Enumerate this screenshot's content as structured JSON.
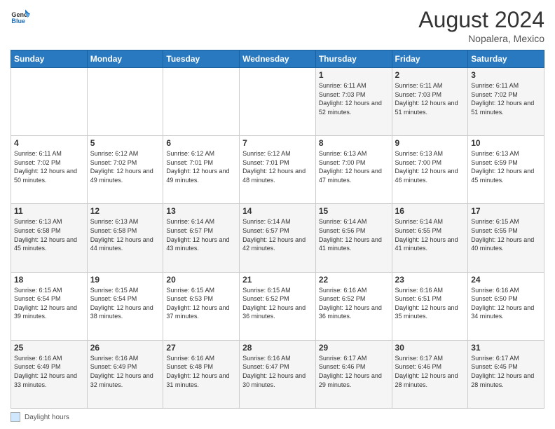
{
  "header": {
    "logo_general": "General",
    "logo_blue": "Blue",
    "month_year": "August 2024",
    "location": "Nopalera, Mexico"
  },
  "footer": {
    "label": "Daylight hours"
  },
  "days": [
    "Sunday",
    "Monday",
    "Tuesday",
    "Wednesday",
    "Thursday",
    "Friday",
    "Saturday"
  ],
  "weeks": [
    [
      {
        "day": "",
        "info": ""
      },
      {
        "day": "",
        "info": ""
      },
      {
        "day": "",
        "info": ""
      },
      {
        "day": "",
        "info": ""
      },
      {
        "day": "1",
        "info": "Sunrise: 6:11 AM\nSunset: 7:03 PM\nDaylight: 12 hours\nand 52 minutes."
      },
      {
        "day": "2",
        "info": "Sunrise: 6:11 AM\nSunset: 7:03 PM\nDaylight: 12 hours\nand 51 minutes."
      },
      {
        "day": "3",
        "info": "Sunrise: 6:11 AM\nSunset: 7:02 PM\nDaylight: 12 hours\nand 51 minutes."
      }
    ],
    [
      {
        "day": "4",
        "info": "Sunrise: 6:11 AM\nSunset: 7:02 PM\nDaylight: 12 hours\nand 50 minutes."
      },
      {
        "day": "5",
        "info": "Sunrise: 6:12 AM\nSunset: 7:02 PM\nDaylight: 12 hours\nand 49 minutes."
      },
      {
        "day": "6",
        "info": "Sunrise: 6:12 AM\nSunset: 7:01 PM\nDaylight: 12 hours\nand 49 minutes."
      },
      {
        "day": "7",
        "info": "Sunrise: 6:12 AM\nSunset: 7:01 PM\nDaylight: 12 hours\nand 48 minutes."
      },
      {
        "day": "8",
        "info": "Sunrise: 6:13 AM\nSunset: 7:00 PM\nDaylight: 12 hours\nand 47 minutes."
      },
      {
        "day": "9",
        "info": "Sunrise: 6:13 AM\nSunset: 7:00 PM\nDaylight: 12 hours\nand 46 minutes."
      },
      {
        "day": "10",
        "info": "Sunrise: 6:13 AM\nSunset: 6:59 PM\nDaylight: 12 hours\nand 45 minutes."
      }
    ],
    [
      {
        "day": "11",
        "info": "Sunrise: 6:13 AM\nSunset: 6:58 PM\nDaylight: 12 hours\nand 45 minutes."
      },
      {
        "day": "12",
        "info": "Sunrise: 6:13 AM\nSunset: 6:58 PM\nDaylight: 12 hours\nand 44 minutes."
      },
      {
        "day": "13",
        "info": "Sunrise: 6:14 AM\nSunset: 6:57 PM\nDaylight: 12 hours\nand 43 minutes."
      },
      {
        "day": "14",
        "info": "Sunrise: 6:14 AM\nSunset: 6:57 PM\nDaylight: 12 hours\nand 42 minutes."
      },
      {
        "day": "15",
        "info": "Sunrise: 6:14 AM\nSunset: 6:56 PM\nDaylight: 12 hours\nand 41 minutes."
      },
      {
        "day": "16",
        "info": "Sunrise: 6:14 AM\nSunset: 6:55 PM\nDaylight: 12 hours\nand 41 minutes."
      },
      {
        "day": "17",
        "info": "Sunrise: 6:15 AM\nSunset: 6:55 PM\nDaylight: 12 hours\nand 40 minutes."
      }
    ],
    [
      {
        "day": "18",
        "info": "Sunrise: 6:15 AM\nSunset: 6:54 PM\nDaylight: 12 hours\nand 39 minutes."
      },
      {
        "day": "19",
        "info": "Sunrise: 6:15 AM\nSunset: 6:54 PM\nDaylight: 12 hours\nand 38 minutes."
      },
      {
        "day": "20",
        "info": "Sunrise: 6:15 AM\nSunset: 6:53 PM\nDaylight: 12 hours\nand 37 minutes."
      },
      {
        "day": "21",
        "info": "Sunrise: 6:15 AM\nSunset: 6:52 PM\nDaylight: 12 hours\nand 36 minutes."
      },
      {
        "day": "22",
        "info": "Sunrise: 6:16 AM\nSunset: 6:52 PM\nDaylight: 12 hours\nand 36 minutes."
      },
      {
        "day": "23",
        "info": "Sunrise: 6:16 AM\nSunset: 6:51 PM\nDaylight: 12 hours\nand 35 minutes."
      },
      {
        "day": "24",
        "info": "Sunrise: 6:16 AM\nSunset: 6:50 PM\nDaylight: 12 hours\nand 34 minutes."
      }
    ],
    [
      {
        "day": "25",
        "info": "Sunrise: 6:16 AM\nSunset: 6:49 PM\nDaylight: 12 hours\nand 33 minutes."
      },
      {
        "day": "26",
        "info": "Sunrise: 6:16 AM\nSunset: 6:49 PM\nDaylight: 12 hours\nand 32 minutes."
      },
      {
        "day": "27",
        "info": "Sunrise: 6:16 AM\nSunset: 6:48 PM\nDaylight: 12 hours\nand 31 minutes."
      },
      {
        "day": "28",
        "info": "Sunrise: 6:16 AM\nSunset: 6:47 PM\nDaylight: 12 hours\nand 30 minutes."
      },
      {
        "day": "29",
        "info": "Sunrise: 6:17 AM\nSunset: 6:46 PM\nDaylight: 12 hours\nand 29 minutes."
      },
      {
        "day": "30",
        "info": "Sunrise: 6:17 AM\nSunset: 6:46 PM\nDaylight: 12 hours\nand 28 minutes."
      },
      {
        "day": "31",
        "info": "Sunrise: 6:17 AM\nSunset: 6:45 PM\nDaylight: 12 hours\nand 28 minutes."
      }
    ]
  ]
}
